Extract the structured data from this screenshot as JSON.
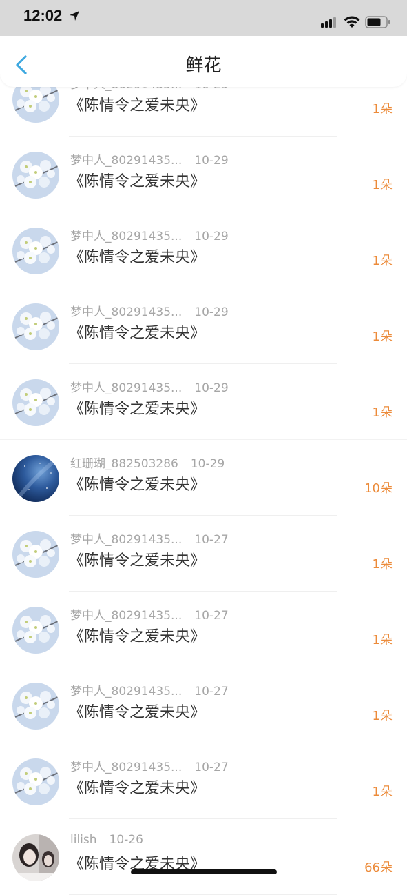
{
  "status_bar": {
    "time": "12:02",
    "icons": [
      "location-arrow-icon",
      "signal-icon",
      "wifi-icon",
      "battery-icon"
    ]
  },
  "nav": {
    "title": "鲜花",
    "back_icon": "chevron-left-icon"
  },
  "colors": {
    "accent": "#3da8e0",
    "count": "#ec8b3a",
    "meta": "#a6a6a6"
  },
  "items": [
    {
      "name": "梦中人_80291435...",
      "date": "10-29",
      "book": "《陈情令之爱未央》",
      "count": "1朵",
      "avatar": "blossom-avatar"
    },
    {
      "name": "梦中人_80291435...",
      "date": "10-29",
      "book": "《陈情令之爱未央》",
      "count": "1朵",
      "avatar": "blossom-avatar"
    },
    {
      "name": "梦中人_80291435...",
      "date": "10-29",
      "book": "《陈情令之爱未央》",
      "count": "1朵",
      "avatar": "blossom-avatar"
    },
    {
      "name": "梦中人_80291435...",
      "date": "10-29",
      "book": "《陈情令之爱未央》",
      "count": "1朵",
      "avatar": "blossom-avatar"
    },
    {
      "name": "梦中人_80291435...",
      "date": "10-29",
      "book": "《陈情令之爱未央》",
      "count": "1朵",
      "avatar": "blossom-avatar"
    },
    {
      "name": "红珊瑚_882503286",
      "date": "10-29",
      "book": "《陈情令之爱未央》",
      "count": "10朵",
      "avatar": "galaxy-avatar"
    },
    {
      "name": "梦中人_80291435...",
      "date": "10-27",
      "book": "《陈情令之爱未央》",
      "count": "1朵",
      "avatar": "blossom-avatar"
    },
    {
      "name": "梦中人_80291435...",
      "date": "10-27",
      "book": "《陈情令之爱未央》",
      "count": "1朵",
      "avatar": "blossom-avatar"
    },
    {
      "name": "梦中人_80291435...",
      "date": "10-27",
      "book": "《陈情令之爱未央》",
      "count": "1朵",
      "avatar": "blossom-avatar"
    },
    {
      "name": "梦中人_80291435...",
      "date": "10-27",
      "book": "《陈情令之爱未央》",
      "count": "1朵",
      "avatar": "blossom-avatar"
    },
    {
      "name": "lilish",
      "date": "10-26",
      "book": "《陈情令之爱未央》",
      "count": "66朵",
      "avatar": "portrait-avatar"
    }
  ]
}
